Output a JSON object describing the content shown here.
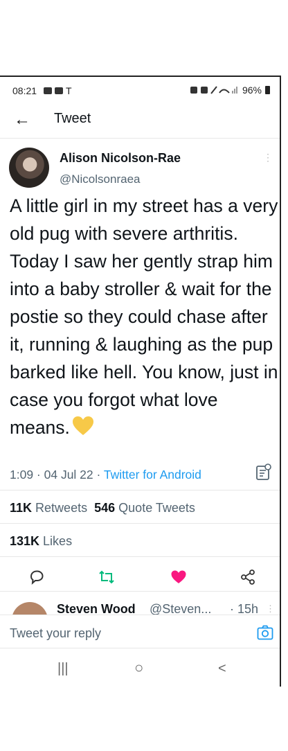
{
  "status": {
    "time": "08:21",
    "carrier_icon": "T",
    "battery": "96%"
  },
  "header": {
    "back_icon": "←",
    "title": "Tweet"
  },
  "tweet": {
    "name": "Alison Nicolson-Rae",
    "handle": "@Nicolsonraea",
    "text": "A little girl in my street has a very old pug with severe arthritis. Today I saw her gently strap him into a baby stroller & wait for the postie so they could chase after it, running & laughing as the pup barked like hell. You know, just in case you forgot what love means.",
    "timestamp": "1:09 · 04 Jul 22 · ",
    "source": "Twitter for Android",
    "retweets_count": "11K",
    "retweets_label": "Retweets",
    "quotes_count": "546",
    "quotes_label": "Quote Tweets",
    "likes_count": "131K",
    "likes_label": "Likes",
    "emoji_color": "#f7c948",
    "retweet_color": "#00ba7c",
    "like_color": "#f91880",
    "link_color": "#1d9bf0"
  },
  "reply": {
    "name": "Steven Wood",
    "handle": "@Steven...",
    "time": "· 15h"
  },
  "compose": {
    "placeholder": "Tweet your reply"
  },
  "icons": [
    "back-arrow-icon",
    "more-icon",
    "analytics-icon",
    "reply-icon",
    "retweet-icon",
    "like-icon",
    "share-icon",
    "camera-icon"
  ],
  "nav": {
    "recents": "|||",
    "home": "○",
    "back": "<"
  }
}
